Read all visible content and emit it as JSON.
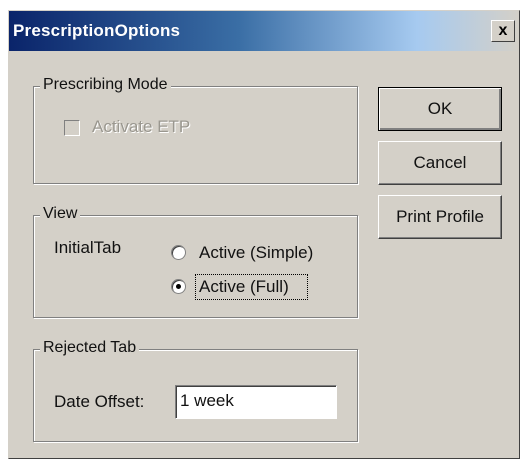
{
  "window": {
    "title": "PrescriptionOptions",
    "close_label": "x"
  },
  "prescribing_mode": {
    "legend": "Prescribing Mode",
    "activate_etp": {
      "label": "Activate ETP",
      "checked": false,
      "enabled": false
    }
  },
  "view": {
    "legend": "View",
    "initial_tab_label": "InitialTab",
    "options": [
      {
        "label": "Active (Simple)",
        "selected": false
      },
      {
        "label": "Active (Full)",
        "selected": true
      }
    ]
  },
  "rejected_tab": {
    "legend": "Rejected Tab",
    "date_offset_label": "Date Offset:",
    "date_offset_value": "1 week"
  },
  "buttons": {
    "ok": "OK",
    "cancel": "Cancel",
    "print_profile": "Print Profile"
  }
}
